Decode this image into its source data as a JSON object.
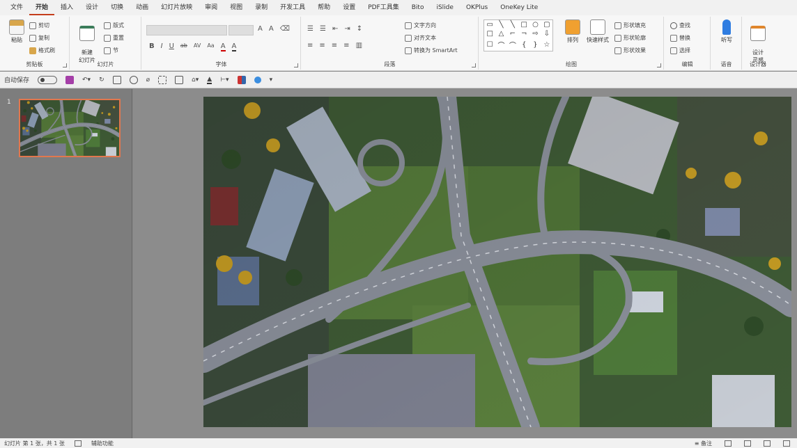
{
  "menu": {
    "tabs": [
      "文件",
      "开始",
      "插入",
      "设计",
      "切换",
      "动画",
      "幻灯片放映",
      "审阅",
      "视图",
      "录制",
      "开发工具",
      "帮助",
      "设置",
      "PDF工具集",
      "Bito",
      "iSlide",
      "OKPlus",
      "OneKey Lite"
    ],
    "active_index": 1
  },
  "ribbon": {
    "clipboard": {
      "label": "剪贴板",
      "paste": "粘贴",
      "cut": "剪切",
      "copy": "复制",
      "format_painter": "格式刷"
    },
    "slides": {
      "label": "幻灯片",
      "new_slide": "新建\n幻灯片",
      "layout": "版式",
      "reset": "重置",
      "section": "节"
    },
    "font": {
      "label": "字体",
      "bold": "B",
      "italic": "I",
      "underline": "U",
      "strike": "ab",
      "spacing": "AV",
      "case": "Aa"
    },
    "paragraph": {
      "label": "段落",
      "text_direction": "文字方向",
      "align_text": "对齐文本",
      "smartart": "转换为 SmartArt"
    },
    "drawing": {
      "label": "绘图",
      "arrange": "排列",
      "quick_styles": "快速样式",
      "shape_fill": "形状填充",
      "shape_outline": "形状轮廓",
      "shape_effects": "形状效果"
    },
    "editing": {
      "label": "编辑",
      "find": "查找",
      "replace": "替换",
      "select": "选择"
    },
    "voice": {
      "label": "语音",
      "dictate": "听写"
    },
    "designer": {
      "label": "设计器",
      "design_ideas": "设计\n灵感"
    }
  },
  "qat": {
    "autosave": "自动保存"
  },
  "thumbnails": [
    {
      "number": "1"
    }
  ],
  "statusbar": {
    "slide_info": "幻灯片 第 1 张，共 1 张",
    "notes": "备注",
    "accessibility": "辅助功能"
  },
  "colors": {
    "accent": "#c43e1c",
    "thumb_border": "#e2774e"
  }
}
